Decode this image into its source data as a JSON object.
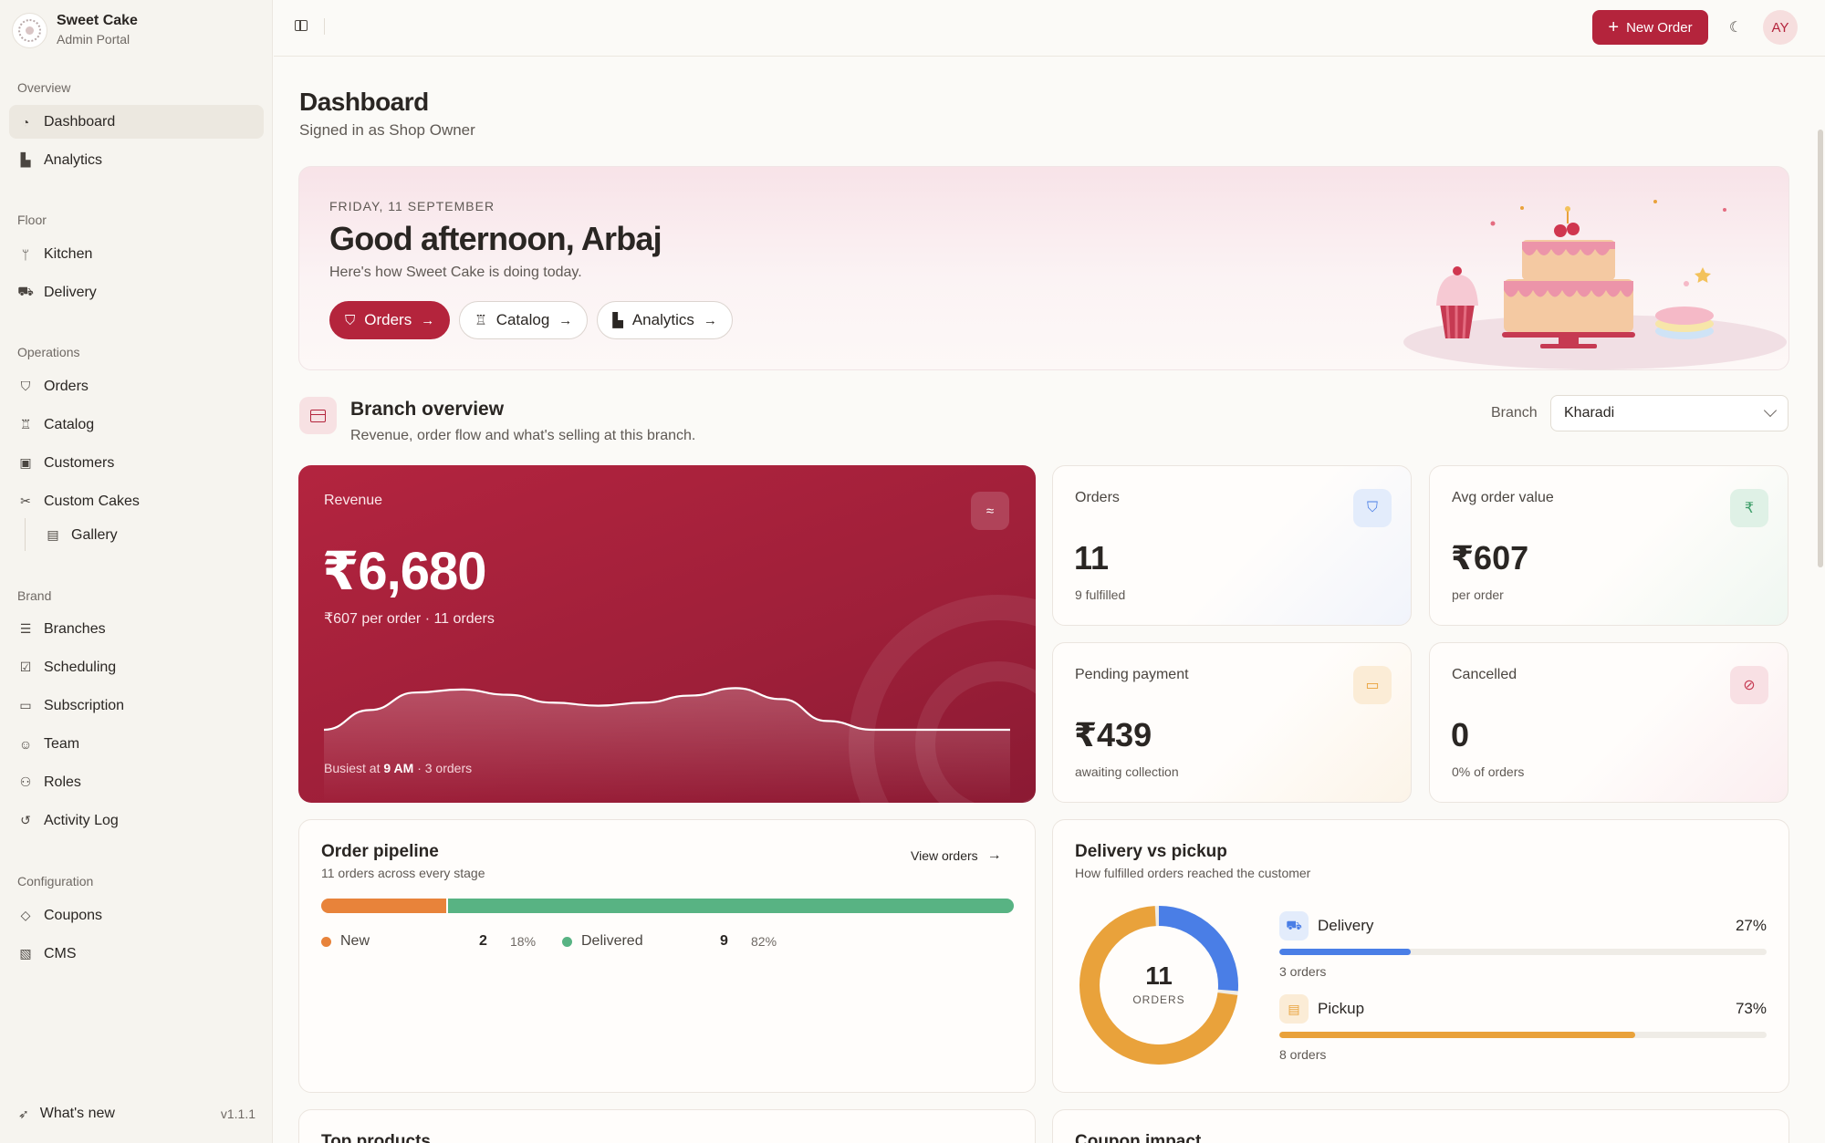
{
  "brand": {
    "name": "Sweet Cake",
    "subtitle": "Admin Portal"
  },
  "sidebar": {
    "sections": {
      "overview": "Overview",
      "floor": "Floor",
      "operations": "Operations",
      "brand": "Brand",
      "configuration": "Configuration"
    },
    "items": {
      "dashboard": "Dashboard",
      "analytics": "Analytics",
      "kitchen": "Kitchen",
      "delivery": "Delivery",
      "orders": "Orders",
      "catalog": "Catalog",
      "customers": "Customers",
      "custom_cakes": "Custom Cakes",
      "gallery": "Gallery",
      "branches": "Branches",
      "scheduling": "Scheduling",
      "subscription": "Subscription",
      "team": "Team",
      "roles": "Roles",
      "activity_log": "Activity Log",
      "coupons": "Coupons",
      "cms": "CMS"
    },
    "footer": {
      "whats_new": "What's new",
      "version": "v1.1.1"
    }
  },
  "topbar": {
    "new_order": "New Order",
    "avatar_initials": "AY"
  },
  "page": {
    "title": "Dashboard",
    "subtitle": "Signed in as Shop Owner"
  },
  "hero": {
    "date": "FRIDAY, 11 SEPTEMBER",
    "greeting": "Good afternoon, Arbaj",
    "subtitle": "Here's how Sweet Cake is doing today.",
    "buttons": {
      "orders": "Orders",
      "catalog": "Catalog",
      "analytics": "Analytics"
    }
  },
  "branch_overview": {
    "title": "Branch overview",
    "subtitle": "Revenue, order flow and what's selling at this branch.",
    "branch_label": "Branch",
    "branch_value": "Kharadi"
  },
  "revenue": {
    "label": "Revenue",
    "value": "₹6,680",
    "meta": "₹607 per order · 11 orders",
    "busiest_prefix": "Busiest at ",
    "busiest_time": "9 AM",
    "busiest_suffix": " · 3 orders",
    "trend": [
      0.0,
      0.45,
      0.85,
      0.92,
      0.8,
      0.62,
      0.55,
      0.62,
      0.78,
      0.95,
      0.7,
      0.2,
      0.0,
      0.0,
      0.0,
      0.0
    ]
  },
  "stats": {
    "orders": {
      "label": "Orders",
      "value": "11",
      "meta": "9 fulfilled"
    },
    "aov": {
      "label": "Avg order value",
      "value": "₹607",
      "meta": "per order"
    },
    "pending": {
      "label": "Pending payment",
      "value": "₹439",
      "meta": "awaiting collection"
    },
    "cancelled": {
      "label": "Cancelled",
      "value": "0",
      "meta": "0% of orders"
    }
  },
  "pipeline": {
    "title": "Order pipeline",
    "subtitle": "11 orders across every stage",
    "view_link": "View orders",
    "stages": [
      {
        "name": "New",
        "count": "2",
        "pct": "18%",
        "fraction": 0.18,
        "color": "#e8833a"
      },
      {
        "name": "Delivered",
        "count": "9",
        "pct": "82%",
        "fraction": 0.82,
        "color": "#58b383"
      }
    ]
  },
  "fulfilment": {
    "title": "Delivery vs pickup",
    "subtitle": "How fulfilled orders reached the customer",
    "total": "11",
    "total_label": "ORDERS",
    "modes": [
      {
        "name": "Delivery",
        "pct": "27%",
        "fraction": 0.27,
        "orders": "3 orders",
        "color": "#4a7ee6",
        "bg": "#e3ecfb",
        "icon": "truck-icon"
      },
      {
        "name": "Pickup",
        "pct": "73%",
        "fraction": 0.73,
        "orders": "8 orders",
        "color": "#e9a23b",
        "bg": "#fbecd6",
        "icon": "store-icon"
      }
    ]
  },
  "below_fold": {
    "top_products": "Top products",
    "coupon_impact": "Coupon impact"
  },
  "colors": {
    "accent": "#b4243c",
    "sidebar_bg": "#f6f4ef",
    "page_bg": "#fbfaf7"
  }
}
